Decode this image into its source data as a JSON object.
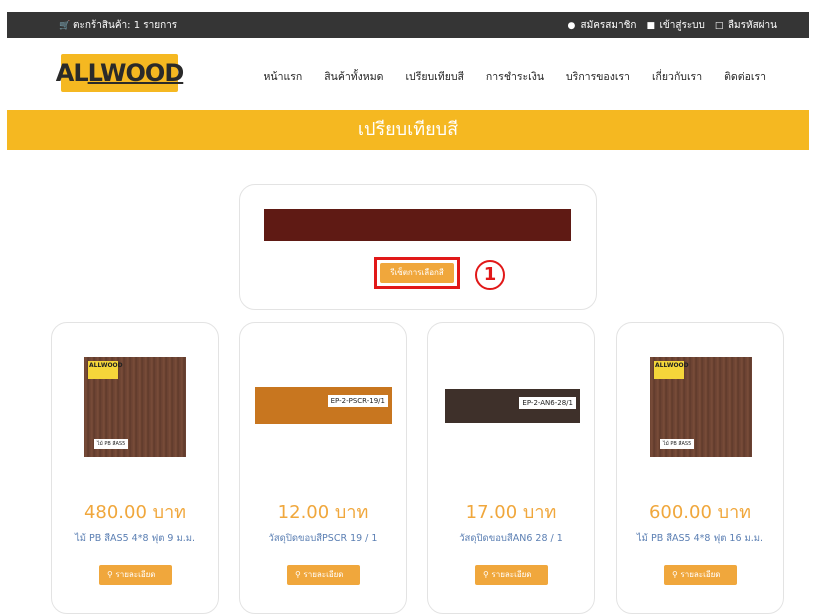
{
  "topbar": {
    "cart_label": "ตะกร้าสินค้า: 1 รายการ",
    "register": "สมัครสมาชิก",
    "login": "เข้าสู่ระบบ",
    "forgot": "ลืมรหัสผ่าน"
  },
  "logo": {
    "part1": "AL",
    "part2": "LWOOD"
  },
  "nav": [
    "หน้าแรก",
    "สินค้าทั้งหมด",
    "เปรียบเทียบสี",
    "การชำระเงิน",
    "บริการของเรา",
    "เกี่ยวกับเรา",
    "ติดต่อเรา"
  ],
  "banner": {
    "title": "เปรียบเทียบสี"
  },
  "compare": {
    "swatch_color": "#5f1a14",
    "button_label": "รีเซ็ตการเลือกสี",
    "marker": "1"
  },
  "products": [
    {
      "price": "480.00 บาท",
      "name": "ไม้ PB สีAS5 4*8 ฟุต 9 ม.ม.",
      "detail_label": "รายละเอียด",
      "image": "board",
      "tag": "ALLWOOD",
      "img_label": "ไม้ PB สีAS5"
    },
    {
      "price": "12.00 บาท",
      "name": "วัสดุปิดขอบสีPSCR 19 / 1",
      "detail_label": "รายละเอียด",
      "image": "strip",
      "img_label": "EP-2-PSCR-19/1",
      "color": "#c8761f"
    },
    {
      "price": "17.00 บาท",
      "name": "วัสดุปิดขอบสีAN6 28 / 1",
      "detail_label": "รายละเอียด",
      "image": "strip",
      "img_label": "EP-2-AN6-28/1",
      "color": "#3e302a"
    },
    {
      "price": "600.00 บาท",
      "name": "ไม้ PB สีAS5 4*8 ฟุต 16 ม.ม.",
      "detail_label": "รายละเอียด",
      "image": "board",
      "tag": "ALLWOOD",
      "img_label": "ไม้ PB สีAS5"
    }
  ]
}
